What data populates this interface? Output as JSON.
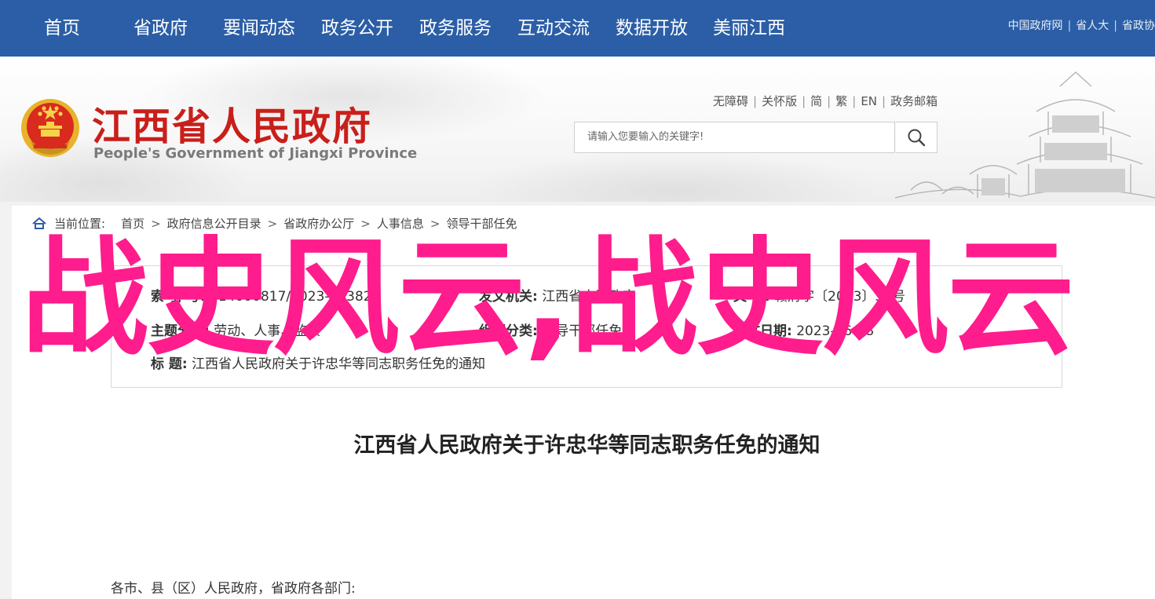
{
  "nav": {
    "items": [
      "首页",
      "省政府",
      "要闻动态",
      "政务公开",
      "政务服务",
      "互动交流",
      "数据开放",
      "美丽江西"
    ],
    "links": [
      "中国政府网",
      "省人大",
      "省政协"
    ]
  },
  "header": {
    "title": "江西省人民政府",
    "subtitle": "People's Government of Jiangxi Province",
    "util_links": [
      "无障碍",
      "关怀版",
      "简",
      "繁",
      "EN",
      "政务邮箱"
    ],
    "search_placeholder": "请输入您要输入的关键字!"
  },
  "breadcrumb": {
    "label": "当前位置:",
    "items": [
      "首页",
      "政府信息公开目录",
      "省政府办公厅",
      "人事信息",
      "领导干部任免"
    ]
  },
  "info": {
    "index_key": "索 引 号:",
    "index_val": "014000817/2023-75382",
    "issuer_key": "发文机关:",
    "issuer_val": "江西省人民政府",
    "docno_key": "文 号:",
    "docno_val": "赣府字〔2023〕38号",
    "subject_key": "主题分类:",
    "subject_val": "劳动、人事、监察",
    "category_key": "组配分类:",
    "category_val": "领导干部任免",
    "date_key": "成文日期:",
    "date_val": "2023-06-08",
    "title_key": "标 题:",
    "title_val": "江西省人民政府关于许忠华等同志职务任免的通知"
  },
  "overlay": "战史风云,战史风云",
  "article": {
    "title": "江西省人民政府关于许忠华等同志职务任免的通知",
    "salutation": "各市、县（区）人民政府，省政府各部门:"
  },
  "colors": {
    "nav_bg": "#2b5ea6",
    "title_red": "#c91f1b",
    "overlay_pink": "#ff1c8d"
  },
  "icons": [
    "national-emblem-icon",
    "search-icon",
    "home-icon",
    "pavilion-illustration"
  ]
}
